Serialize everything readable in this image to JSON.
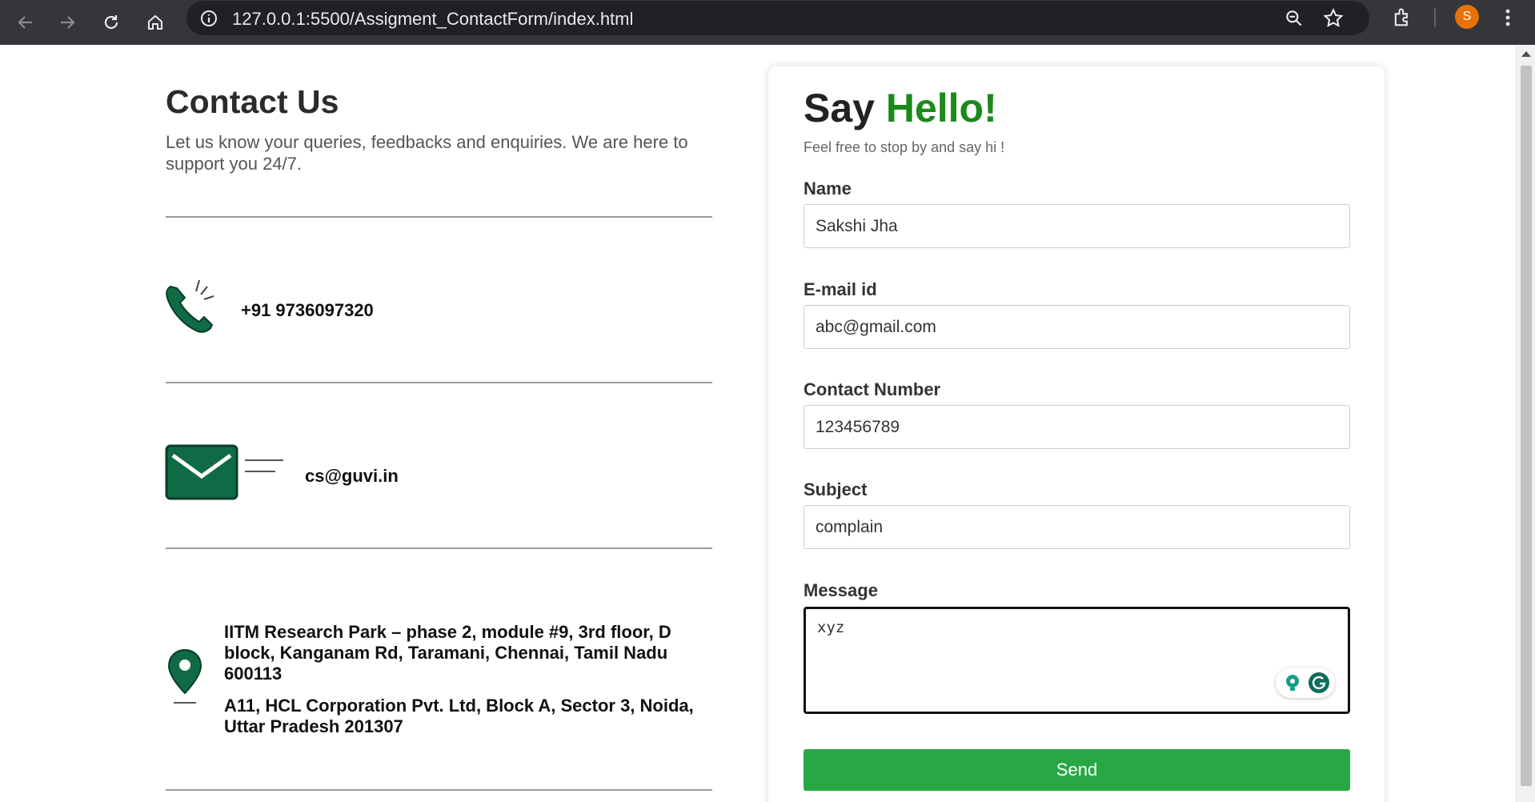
{
  "browser": {
    "url": "127.0.0.1:5500/Assigment_ContactForm/index.html",
    "profile_initial": "S"
  },
  "contact": {
    "title": "Contact Us",
    "description": "Let us know your queries, feedbacks and enquiries. We are here to support you 24/7.",
    "phone": "+91 9736097320",
    "email": "cs@guvi.in",
    "address_1": "IITM Research Park – phase 2, module #9, 3rd floor, D block, Kanganam Rd, Taramani, Chennai, Tamil Nadu 600113",
    "address_2": "A11, HCL Corporation Pvt. Ltd, Block A, Sector 3, Noida, Uttar Pradesh 201307"
  },
  "form": {
    "title_main": "Say ",
    "title_accent": "Hello!",
    "subtitle": "Feel free to stop by and say hi !",
    "name_label": "Name",
    "name_value": "Sakshi Jha",
    "email_label": "E-mail id",
    "email_value": "abc@gmail.com",
    "contact_label": "Contact Number",
    "contact_value": "123456789",
    "subject_label": "Subject",
    "subject_value": "complain",
    "message_label": "Message",
    "message_value": "xyz",
    "send_label": "Send"
  },
  "colors": {
    "accent_green": "#1a8a1a",
    "button_green": "#28a745",
    "icon_green": "#0f6b45",
    "chrome_dark": "#35363a"
  }
}
